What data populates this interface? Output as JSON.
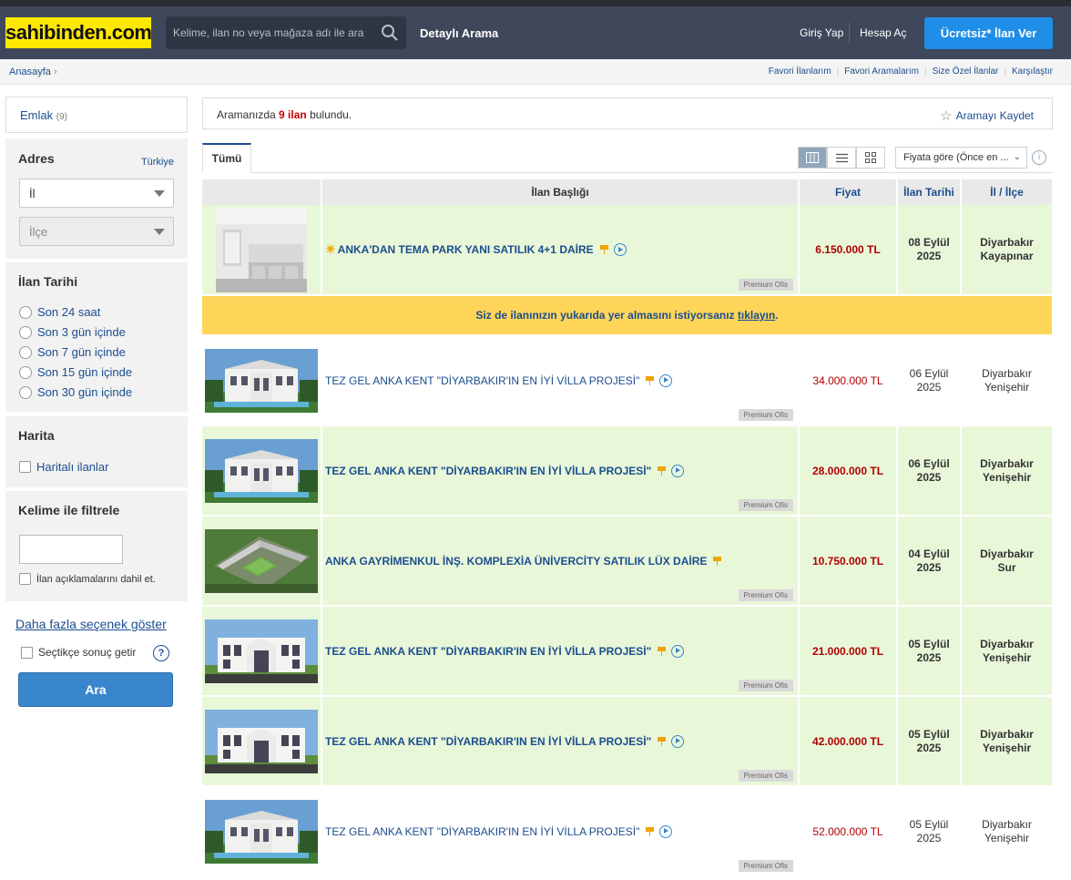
{
  "header": {
    "logo": "sahibinden.com",
    "search_placeholder": "Kelime, ilan no veya mağaza adı ile ara",
    "detailed_search": "Detaylı Arama",
    "login": "Giriş Yap",
    "register": "Hesap Aç",
    "post_ad": "Ücretsiz* İlan Ver"
  },
  "breadcrumb": {
    "home": "Anasayfa"
  },
  "top_links": [
    "Favori İlanlarım",
    "Favori Aramalarım",
    "Size Özel İlanlar",
    "Karşılaştır"
  ],
  "sidebar": {
    "category": {
      "label": "Emlak",
      "count": "(9)"
    },
    "address": {
      "title": "Adres",
      "country": "Türkiye",
      "province": "İl",
      "district": "İlçe"
    },
    "date": {
      "title": "İlan Tarihi",
      "options": [
        "Son 24 saat",
        "Son 3 gün içinde",
        "Son 7 gün içinde",
        "Son 15 gün içinde",
        "Son 30 gün içinde"
      ]
    },
    "map": {
      "title": "Harita",
      "option": "Haritalı ilanlar"
    },
    "keyword": {
      "title": "Kelime ile filtrele",
      "value": "",
      "include_desc": "İlan açıklamalarını dahil et."
    },
    "more_options": "Daha fazla seçenek göster",
    "live_results": "Seçtikçe sonuç getir",
    "help": "?",
    "search_button": "Ara"
  },
  "results": {
    "prefix": "Aramanızda",
    "count": "9 ilan",
    "suffix": "bulundu.",
    "save_search": "Aramayı Kaydet"
  },
  "tabs": [
    "Tümü"
  ],
  "sort": {
    "selected": "Fiyata göre (Önce en ..."
  },
  "info_icon": "i",
  "table": {
    "headers": [
      "",
      "İlan Başlığı",
      "Fiyat",
      "İlan Tarihi",
      "İl / İlçe"
    ],
    "promo": {
      "text": "Siz de ilanınızın yukarıda yer almasını istiyorsanız",
      "link": "tıklayın",
      "end": "."
    },
    "badge": "Premium Ofis",
    "rows": [
      {
        "title": "ANKA'DAN TEMA PARK YANI SATILIK 4+1 DAİRE",
        "price": "6.150.000 TL",
        "date1": "08 Eylül",
        "date2": "2025",
        "city": "Diyarbakır",
        "district": "Kayapınar",
        "style": "bold",
        "bg": "g",
        "sun": true,
        "video": true,
        "thumb": "interior"
      },
      {
        "title": "TEZ GEL ANKA KENT \"DİYARBAKIR'IN EN İYİ VİLLA PROJESİ\"",
        "price": "34.000.000 TL",
        "date1": "06 Eylül",
        "date2": "2025",
        "city": "Diyarbakır",
        "district": "Yenişehir",
        "style": "normal",
        "bg": "w",
        "sun": false,
        "video": true,
        "thumb": "villa"
      },
      {
        "title": "TEZ GEL ANKA KENT \"DİYARBAKIR'IN EN İYİ VİLLA PROJESİ\"",
        "price": "28.000.000 TL",
        "date1": "06 Eylül",
        "date2": "2025",
        "city": "Diyarbakır",
        "district": "Yenişehir",
        "style": "bold",
        "bg": "g",
        "sun": false,
        "video": true,
        "thumb": "villa"
      },
      {
        "title": "ANKA GAYRİMENKUL İNŞ. KOMPLEXİA ÜNİVERCİTY SATILIK LÜX DAİRE",
        "price": "10.750.000 TL",
        "date1": "04 Eylül",
        "date2": "2025",
        "city": "Diyarbakır",
        "district": "Sur",
        "style": "bold",
        "bg": "g",
        "sun": false,
        "video": false,
        "thumb": "aerial"
      },
      {
        "title": "TEZ GEL ANKA KENT \"DİYARBAKIR'IN EN İYİ VİLLA PROJESİ\"",
        "price": "21.000.000 TL",
        "date1": "05 Eylül",
        "date2": "2025",
        "city": "Diyarbakır",
        "district": "Yenişehir",
        "style": "bold",
        "bg": "g",
        "sun": false,
        "video": true,
        "thumb": "villa2"
      },
      {
        "title": "TEZ GEL ANKA KENT \"DİYARBAKIR'IN EN İYİ VİLLA PROJESİ\"",
        "price": "42.000.000 TL",
        "date1": "05 Eylül",
        "date2": "2025",
        "city": "Diyarbakır",
        "district": "Yenişehir",
        "style": "bold",
        "bg": "g",
        "sun": false,
        "video": true,
        "thumb": "villa2"
      },
      {
        "title": "TEZ GEL ANKA KENT \"DİYARBAKIR'IN EN İYİ VİLLA PROJESİ\"",
        "price": "52.000.000 TL",
        "date1": "05 Eylül",
        "date2": "2025",
        "city": "Diyarbakır",
        "district": "Yenişehir",
        "style": "normal",
        "bg": "w",
        "sun": false,
        "video": true,
        "thumb": "villa"
      }
    ]
  }
}
